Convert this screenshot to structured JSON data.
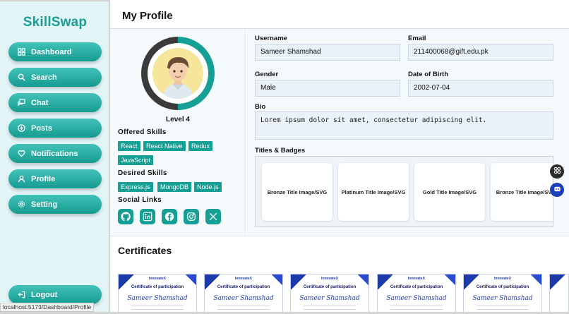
{
  "app": {
    "brand": "SkillSwap"
  },
  "colors": {
    "accent": "#16a095",
    "sidebar_bg": "#e3f4f6",
    "panel_bg": "#f4f9fb"
  },
  "sidebar": {
    "items": [
      {
        "label": "Dashboard",
        "icon": "grid-icon"
      },
      {
        "label": "Search",
        "icon": "search-icon"
      },
      {
        "label": "Chat",
        "icon": "chat-icon"
      },
      {
        "label": "Posts",
        "icon": "plus-circle-icon"
      },
      {
        "label": "Notifications",
        "icon": "heart-icon"
      },
      {
        "label": "Profile",
        "icon": "user-icon"
      },
      {
        "label": "Setting",
        "icon": "gear-icon"
      }
    ],
    "logout_label": "Logout"
  },
  "header": {
    "title": "My Profile"
  },
  "profile": {
    "level_text": "Level 4",
    "level_progress": 0.5,
    "offered_title": "Offered Skills",
    "offered_skills": [
      "React",
      "React Native",
      "Redux",
      "JavaScript"
    ],
    "desired_title": "Desired Skills",
    "desired_skills": [
      "Express.js",
      "MongoDB",
      "Node.js"
    ],
    "social_title": "Social Links",
    "social_icons": [
      "github-icon",
      "linkedin-icon",
      "facebook-icon",
      "instagram-icon",
      "x-icon"
    ]
  },
  "form": {
    "username_label": "Username",
    "username_value": "Sameer Shamshad",
    "email_label": "Email",
    "email_value": "211400068@gift.edu.pk",
    "gender_label": "Gender",
    "gender_value": "Male",
    "dob_label": "Date of Birth",
    "dob_value": "2002-07-04",
    "bio_label": "Bio",
    "bio_value": "Lorem ipsum dolor sit amet, consectetur adipiscing elit.",
    "badges_label": "Titles & Badges",
    "badges": [
      "Bronze Title Image/SVG",
      "Platinum Title Image/SVG",
      "Gold Title Image/SVG",
      "Bronze Title Image/SVG"
    ]
  },
  "certificates": {
    "title": "Certificates",
    "items": [
      {
        "org": "InnovateX",
        "heading": "Certificate of participation",
        "name": "Sameer Shamshad"
      },
      {
        "org": "InnovateX",
        "heading": "Certificate of participation",
        "name": "Sameer Shamshad"
      },
      {
        "org": "InnovateX",
        "heading": "Certificate of participation",
        "name": "Sameer Shamshad"
      },
      {
        "org": "InnovateX",
        "heading": "Certificate of participation",
        "name": "Sameer Shamshad"
      },
      {
        "org": "InnovateX",
        "heading": "Certificate of participation",
        "name": "Sameer Shamshad"
      }
    ]
  },
  "status_url": "localhost:5173/Dashboard/Profile"
}
